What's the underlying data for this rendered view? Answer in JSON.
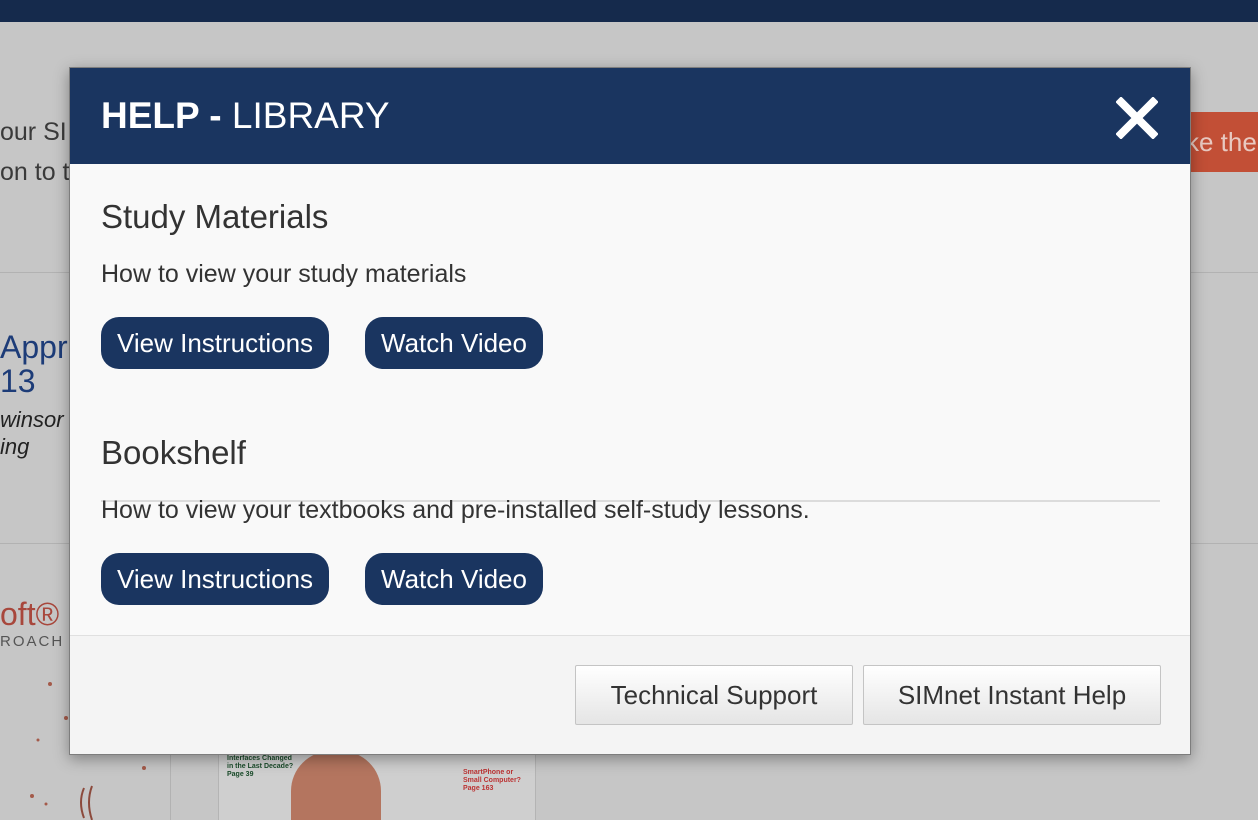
{
  "background": {
    "text_line_1": "our SI",
    "text_line_2": "on to t",
    "orange_button": "ke the",
    "book1": {
      "title_line1": "Appro",
      "title_line2": "13",
      "author_line1": "winsor",
      "author_line2": "ing"
    },
    "book2": {
      "title": "oft® C",
      "subtitle": "ROACH"
    },
    "card": {
      "caption_left": "Interfaces Changed in the Last Decade?",
      "caption_left_page": "Page 39",
      "caption_right": "SmartPhone or Small Computer?",
      "caption_right_page": "Page 163"
    }
  },
  "modal": {
    "title_bold": "HELP -",
    "title_rest": " LIBRARY",
    "close_icon": "close-x-icon",
    "sections": [
      {
        "heading": "Study Materials",
        "description": "How to view your study materials",
        "buttons": [
          "View Instructions",
          "Watch Video"
        ]
      },
      {
        "heading": "Bookshelf",
        "description": "How to view your textbooks and pre-installed self-study lessons.",
        "buttons": [
          "View Instructions",
          "Watch Video"
        ]
      }
    ],
    "footer": {
      "technical_support": "Technical Support",
      "instant_help": "SIMnet Instant Help"
    }
  },
  "colors": {
    "header_bg": "#1a3560",
    "button_bg": "#1a3560",
    "overlay_bg": "#c6c6c6",
    "accent_orange": "#c24f36"
  }
}
